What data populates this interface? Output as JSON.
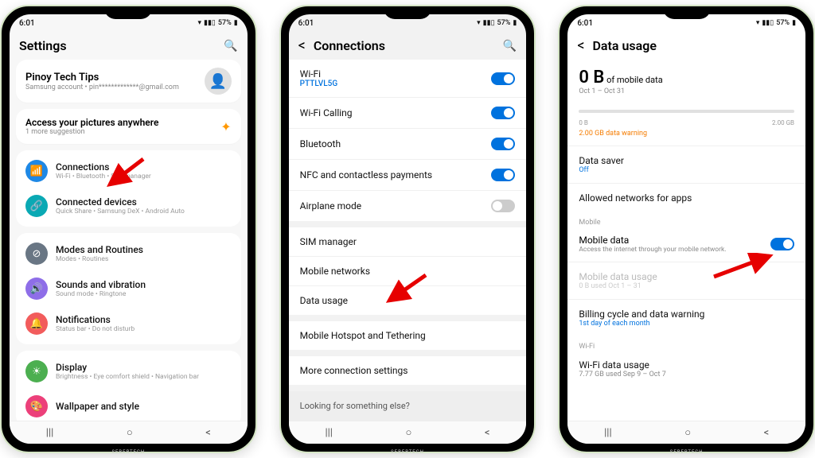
{
  "statusbar": {
    "time": "6:01",
    "battery": "57%",
    "signal": "📶",
    "wifi": "📡"
  },
  "phone1": {
    "title": "Settings",
    "account": {
      "name": "Pinoy Tech Tips",
      "email": "Samsung account • pin*************@gmail.com"
    },
    "suggestion": {
      "title": "Access your pictures anywhere",
      "sub": "1 more suggestion"
    },
    "items": [
      {
        "icon": "📶",
        "bg": "bg-blue",
        "title": "Connections",
        "sub": "Wi-Fi • Bluetooth • SIM manager"
      },
      {
        "icon": "🔗",
        "bg": "bg-teal",
        "title": "Connected devices",
        "sub": "Quick Share • Samsung DeX • Android Auto"
      },
      {
        "icon": "⊘",
        "bg": "bg-gray",
        "title": "Modes and Routines",
        "sub": "Modes • Routines"
      },
      {
        "icon": "🔊",
        "bg": "bg-purple",
        "title": "Sounds and vibration",
        "sub": "Sound mode • Ringtone"
      },
      {
        "icon": "🔔",
        "bg": "bg-red",
        "title": "Notifications",
        "sub": "Status bar • Do not disturb"
      },
      {
        "icon": "☀",
        "bg": "bg-green",
        "title": "Display",
        "sub": "Brightness • Eye comfort shield • Navigation bar"
      },
      {
        "icon": "🎨",
        "bg": "bg-pink",
        "title": "Wallpaper and style",
        "sub": ""
      }
    ]
  },
  "phone2": {
    "title": "Connections",
    "group1": [
      {
        "label": "Wi-Fi",
        "sub": "PTTLVL5G",
        "toggle": "on"
      },
      {
        "label": "Wi-Fi Calling",
        "toggle": "on"
      },
      {
        "label": "Bluetooth",
        "toggle": "on"
      },
      {
        "label": "NFC and contactless payments",
        "toggle": "on"
      },
      {
        "label": "Airplane mode",
        "toggle": "off"
      }
    ],
    "group2": [
      {
        "label": "SIM manager"
      },
      {
        "label": "Mobile networks"
      },
      {
        "label": "Data usage"
      }
    ],
    "group3": [
      {
        "label": "Mobile Hotspot and Tethering"
      }
    ],
    "group4": [
      {
        "label": "More connection settings"
      }
    ],
    "footer": "Looking for something else?"
  },
  "phone3": {
    "title": "Data usage",
    "usage_amount": "0 B",
    "usage_of": " of mobile data",
    "range": "Oct 1 – Oct 31",
    "min": "0 B",
    "max": "2.00 GB",
    "warning": "2.00 GB data warning",
    "items": [
      {
        "t": "Data saver",
        "s": "Off",
        "blue": true
      },
      {
        "t": "Allowed networks for apps"
      }
    ],
    "mobile_label": "Mobile",
    "mobile_row": {
      "t": "Mobile data",
      "s": "Access the internet through your mobile network."
    },
    "mobile_usage": {
      "t": "Mobile data usage",
      "s": "0 B used Oct 1 – 31"
    },
    "billing": {
      "t": "Billing cycle and data warning",
      "s": "1st day of each month",
      "blue": true
    },
    "wifi_label": "Wi-Fi",
    "wifi_row": {
      "t": "Wi-Fi data usage",
      "s": "7.77 GB used Sep 9 – Oct 7"
    }
  },
  "watermark": "SEBERTECH"
}
